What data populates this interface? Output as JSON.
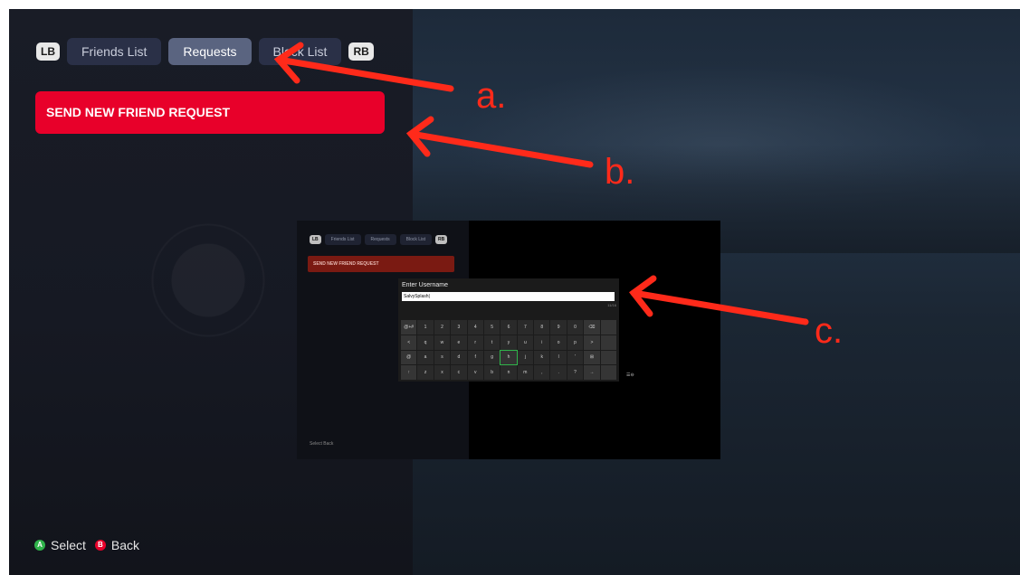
{
  "tabbar": {
    "lb": "LB",
    "rb": "RB",
    "tabs": [
      {
        "label": "Friends List",
        "active": false
      },
      {
        "label": "Requests",
        "active": true
      },
      {
        "label": "Block List",
        "active": false
      }
    ]
  },
  "send_button": {
    "label": "SEND NEW FRIEND REQUEST"
  },
  "footer": {
    "a_label": "Select",
    "b_label": "Back",
    "a_glyph": "A",
    "b_glyph": "B"
  },
  "annotations": {
    "a": "a.",
    "b": "b.",
    "c": "c."
  },
  "inset": {
    "tabbar": {
      "lb": "LB",
      "rb": "RB",
      "tabs": [
        "Friends List",
        "Requests",
        "Block List"
      ]
    },
    "send_label": "SEND NEW FRIEND REQUEST",
    "footer": "Select  Back",
    "dialog": {
      "title": "Enter Username",
      "value": "SalvySplash|",
      "count": "11/16",
      "rows": [
        [
          "@+#",
          "1",
          "2",
          "3",
          "4",
          "5",
          "6",
          "7",
          "8",
          "9",
          "0",
          "⌫"
        ],
        [
          "<",
          "q",
          "w",
          "e",
          "r",
          "t",
          "y",
          "u",
          "i",
          "o",
          "p",
          ">"
        ],
        [
          "@",
          "a",
          "s",
          "d",
          "f",
          "g",
          "h",
          "j",
          "k",
          "l",
          "'",
          "⊞"
        ],
        [
          "↑",
          "z",
          "x",
          "c",
          "v",
          "b",
          "n",
          "m",
          ",",
          ".",
          "?",
          "→"
        ]
      ],
      "focused_key": "h"
    }
  },
  "colors": {
    "accent_red": "#e8002a",
    "annotation_red": "#ff2a1a",
    "a_button": "#2fb34a",
    "b_button": "#e8002a"
  }
}
